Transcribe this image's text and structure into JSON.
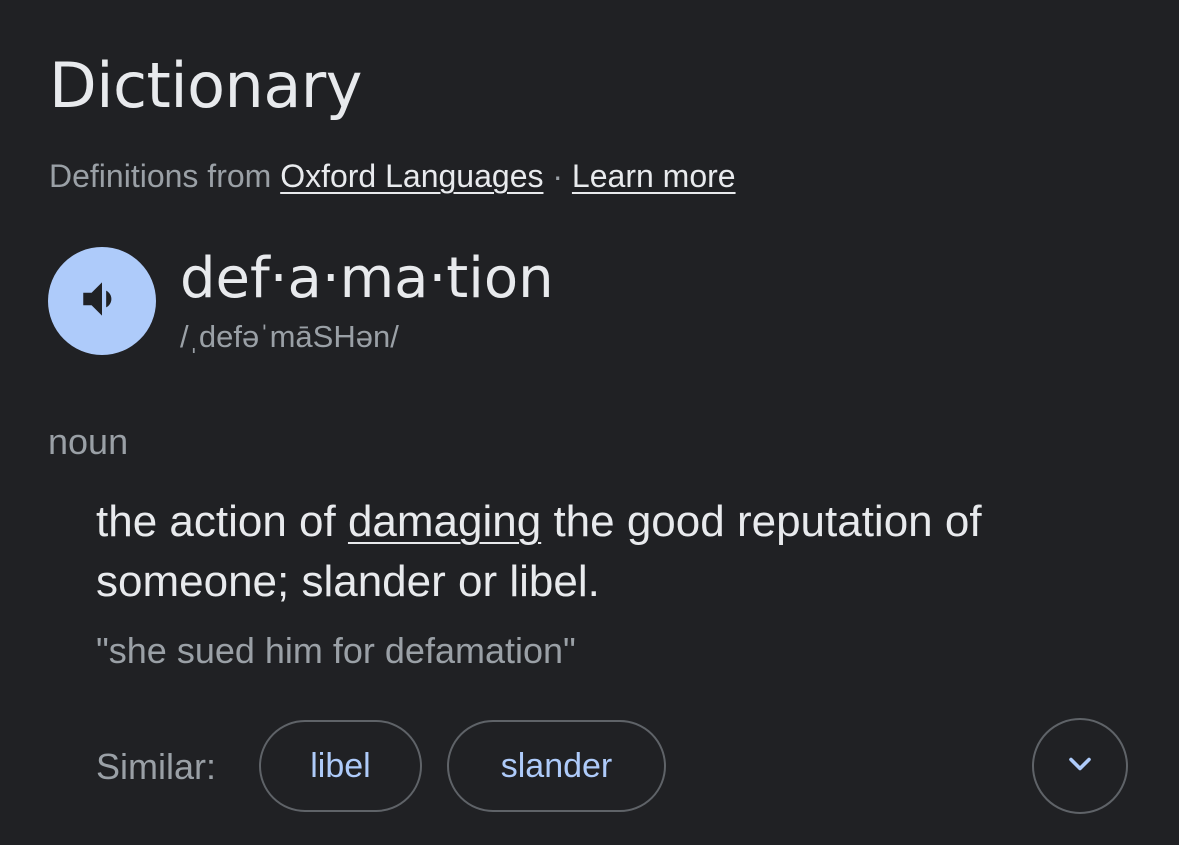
{
  "header": {
    "title": "Dictionary",
    "source_prefix": "Definitions from",
    "source_link": "Oxford Languages",
    "separator": "·",
    "learn_more": "Learn more"
  },
  "entry": {
    "word": "def·a·ma·tion",
    "phonetic": "/ˌdefəˈmāSHən/",
    "speaker_icon": "volume-icon",
    "part_of_speech": "noun",
    "definition": {
      "before": "the action of ",
      "link": "damaging",
      "after": " the good reputation of someone; slander or libel."
    },
    "example": "\"she sued him for defamation\""
  },
  "similar": {
    "label": "Similar:",
    "chips": [
      "libel",
      "slander"
    ],
    "expand_icon": "chevron-down-icon"
  },
  "colors": {
    "background": "#202124",
    "text_primary": "#e8eaed",
    "text_secondary": "#9aa0a6",
    "accent": "#aecbfa",
    "chip_border": "#5f6368"
  }
}
